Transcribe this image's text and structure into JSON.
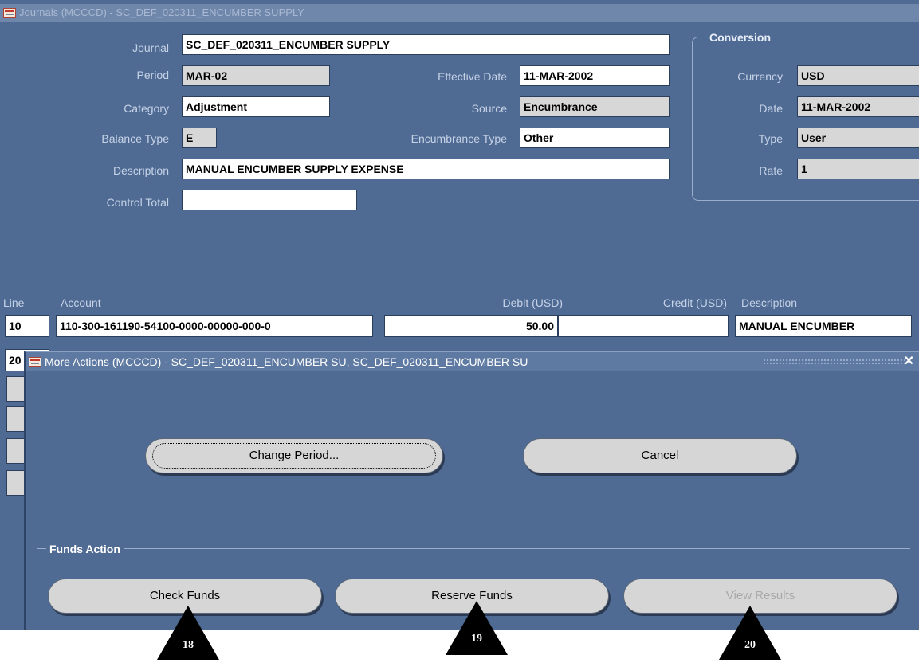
{
  "window": {
    "title": "Journals (MCCCD) - SC_DEF_020311_ENCUMBER SUPPLY"
  },
  "header": {
    "journal_label": "Journal",
    "journal_value": "SC_DEF_020311_ENCUMBER SUPPLY",
    "period_label": "Period",
    "period_value": "MAR-02",
    "effective_date_label": "Effective Date",
    "effective_date_value": "11-MAR-2002",
    "category_label": "Category",
    "category_value": "Adjustment",
    "source_label": "Source",
    "source_value": "Encumbrance",
    "balance_type_label": "Balance Type",
    "balance_type_value": "E",
    "encumbrance_type_label": "Encumbrance Type",
    "encumbrance_type_value": "Other",
    "description_label": "Description",
    "description_value": "MANUAL ENCUMBER SUPPLY EXPENSE",
    "control_total_label": "Control Total",
    "control_total_value": ""
  },
  "conversion": {
    "title": "Conversion",
    "currency_label": "Currency",
    "currency_value": "USD",
    "date_label": "Date",
    "date_value": "11-MAR-2002",
    "type_label": "Type",
    "type_value": "User",
    "rate_label": "Rate",
    "rate_value": "1"
  },
  "lines": {
    "headers": {
      "line": "Line",
      "account": "Account",
      "debit": "Debit (USD)",
      "credit": "Credit (USD)",
      "description": "Description"
    },
    "rows": [
      {
        "line": "10",
        "account": "110-300-161190-54100-0000-00000-000-0",
        "debit": "50.00",
        "credit": "",
        "description": "MANUAL ENCUMBER"
      },
      {
        "line": "20"
      }
    ]
  },
  "dialog": {
    "title": "More Actions (MCCCD) - SC_DEF_020311_ENCUMBER SU, SC_DEF_020311_ENCUMBER SU",
    "close": "✕",
    "change_period_label": "Change Period...",
    "cancel_label": "Cancel",
    "funds_action_title": "Funds Action",
    "check_funds_label": "Check Funds",
    "reserve_funds_label": "Reserve Funds",
    "view_results_label": "View Results"
  },
  "callouts": [
    "18",
    "19",
    "20"
  ]
}
